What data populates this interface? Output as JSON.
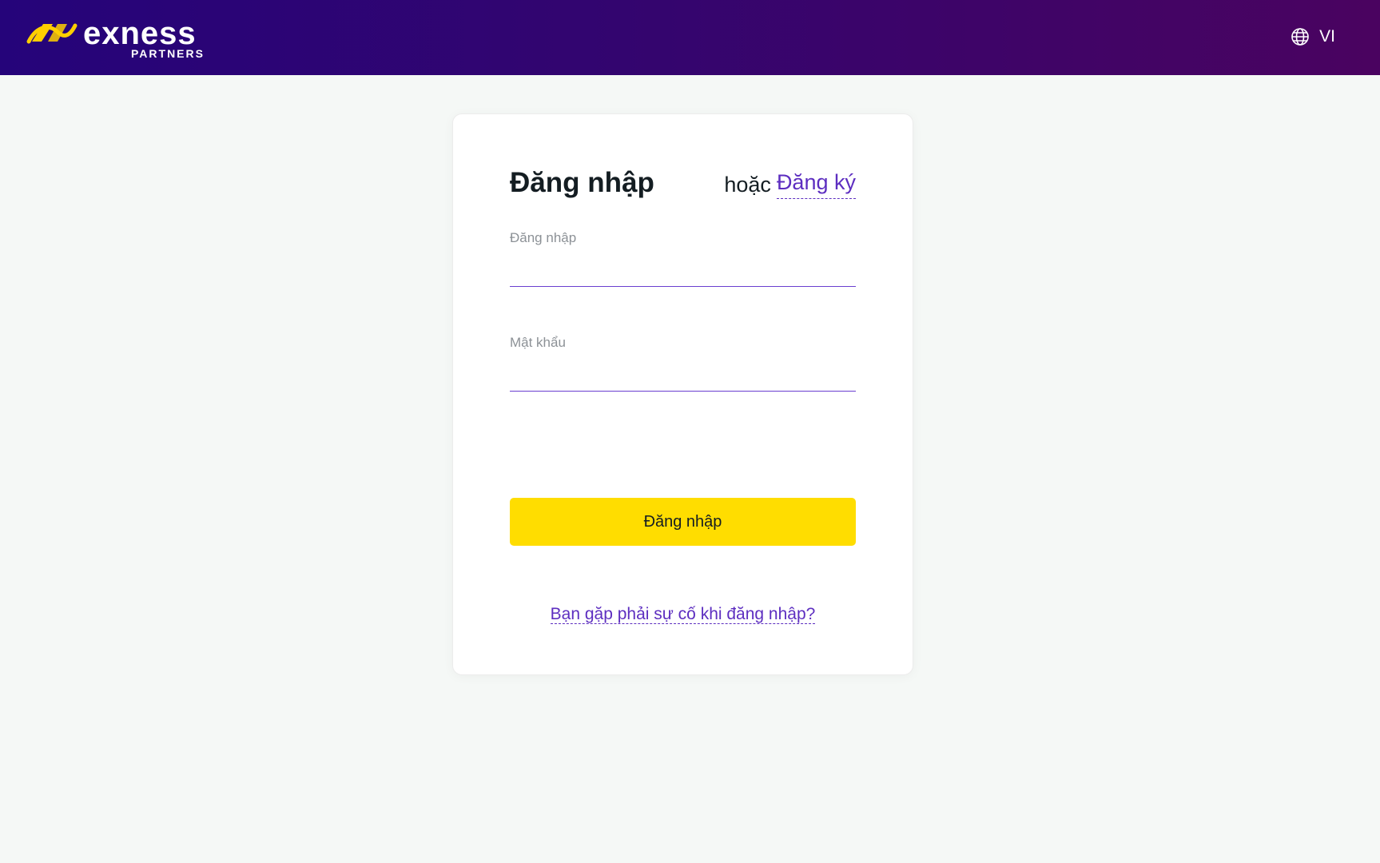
{
  "header": {
    "logo_word": "exness",
    "logo_sub": "PARTNERS",
    "language": "VI",
    "globe_icon": "globe-icon"
  },
  "login": {
    "title": "Đăng nhập",
    "or_text": "hoặc",
    "register_link": "Đăng ký",
    "login_label": "Đăng nhập",
    "login_value": "",
    "password_label": "Mật khẩu",
    "password_value": "",
    "submit_label": "Đăng nhập",
    "trouble_link": "Bạn gặp phải sự cố khi đăng nhập?"
  },
  "colors": {
    "header_start": "#25047a",
    "header_end": "#4a0360",
    "accent": "#5d2ec0",
    "button": "#ffdd00",
    "logo_mark": "#ffcf00"
  }
}
